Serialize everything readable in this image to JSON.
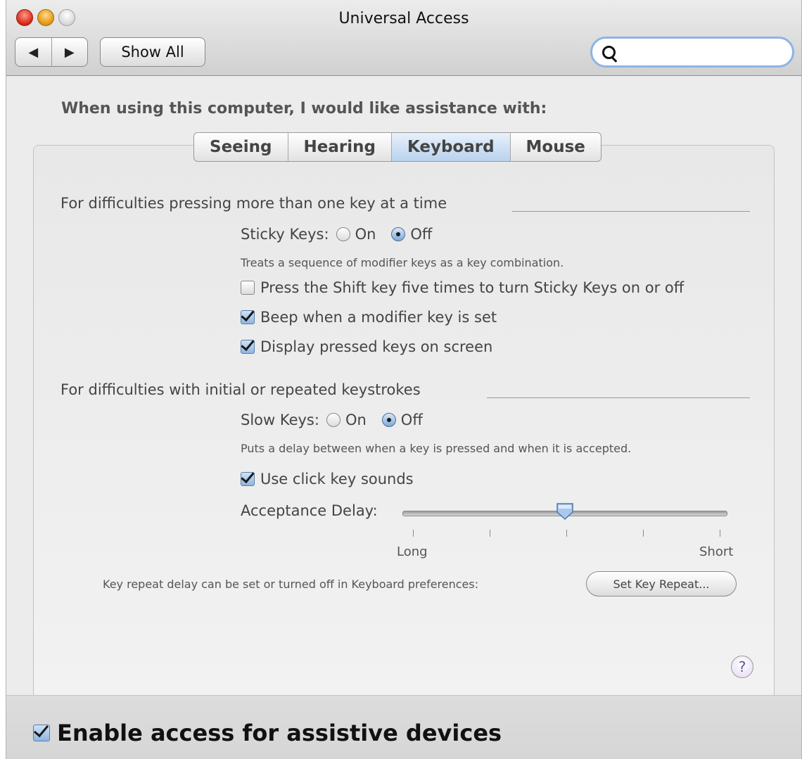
{
  "window": {
    "title": "Universal Access"
  },
  "toolbar": {
    "back_label": "◀",
    "forward_label": "▶",
    "show_all_label": "Show All",
    "search_placeholder": ""
  },
  "main": {
    "heading": "When using this computer, I would like assistance with:",
    "tabs": [
      {
        "label": "Seeing",
        "active": false
      },
      {
        "label": "Hearing",
        "active": false
      },
      {
        "label": "Keyboard",
        "active": true
      },
      {
        "label": "Mouse",
        "active": false
      }
    ]
  },
  "sticky": {
    "section_title": "For difficulties pressing more than one key at a time",
    "label": "Sticky Keys:",
    "on_label": "On",
    "off_label": "Off",
    "selected": "Off",
    "description": "Treats a sequence of modifier keys as a key combination.",
    "options": [
      {
        "label": "Press the Shift key five times to turn Sticky Keys on or off",
        "checked": false
      },
      {
        "label": "Beep when a modifier key is set",
        "checked": true
      },
      {
        "label": "Display pressed keys on screen",
        "checked": true
      }
    ]
  },
  "slow": {
    "section_title": "For difficulties with initial or repeated keystrokes",
    "label": "Slow Keys:",
    "on_label": "On",
    "off_label": "Off",
    "selected": "Off",
    "description": "Puts a delay between when a key is pressed and when it is accepted.",
    "click_sounds": {
      "label": "Use click key sounds",
      "checked": true
    },
    "delay_label": "Acceptance Delay:",
    "delay_level": 0.5,
    "long_label": "Long",
    "short_label": "Short",
    "repeat_text": "Key repeat delay can be set or turned off in Keyboard preferences:",
    "set_repeat_button": "Set Key Repeat..."
  },
  "help_label": "?",
  "footer": {
    "label": "Enable access for assistive devices",
    "checked": true
  }
}
